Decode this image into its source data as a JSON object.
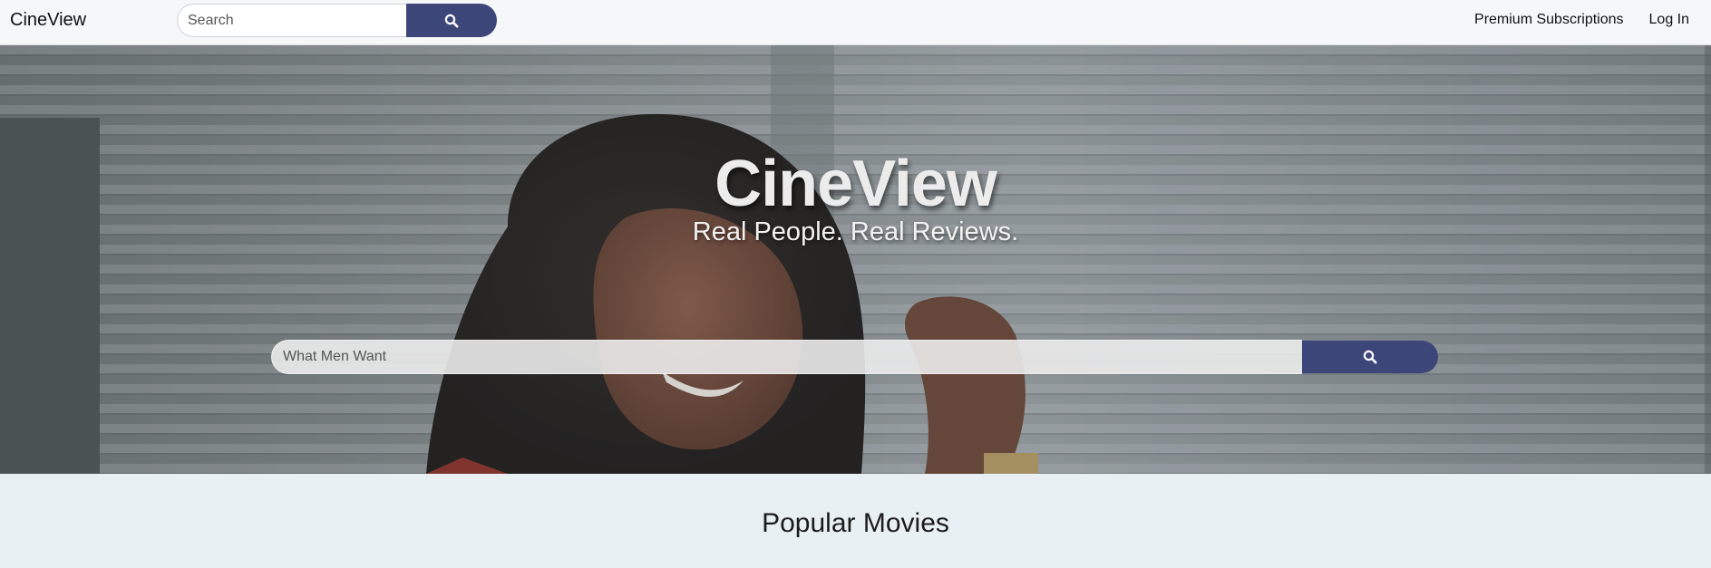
{
  "navbar": {
    "brand": "CineView",
    "search": {
      "placeholder": "Search",
      "button_icon": "search-icon"
    },
    "links": [
      {
        "label": "Premium Subscriptions"
      },
      {
        "label": "Log In"
      }
    ]
  },
  "hero": {
    "title": "CineView",
    "subtitle": "Real People. Real Reviews.",
    "search": {
      "placeholder": "What Men Want",
      "button_icon": "search-icon"
    }
  },
  "popular": {
    "title": "Popular Movies"
  },
  "colors": {
    "accent": "#3d4679",
    "navbar_bg": "#f6f7f9",
    "page_bg": "#e9f0f3"
  }
}
